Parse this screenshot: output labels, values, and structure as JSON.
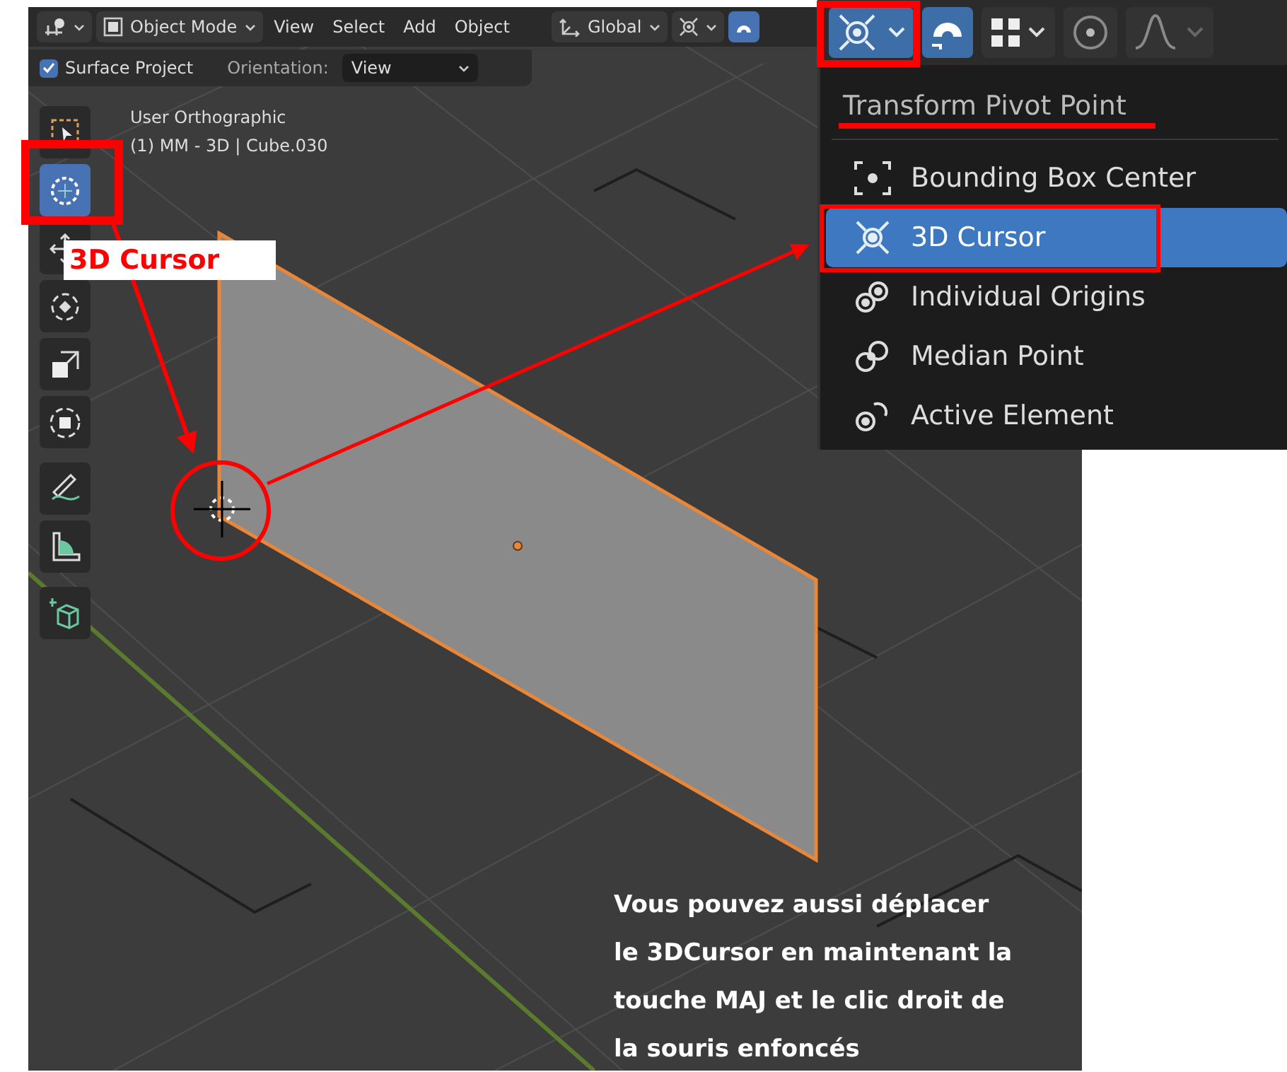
{
  "header": {
    "mode": "Object Mode",
    "menus": [
      "View",
      "Select",
      "Add",
      "Object"
    ],
    "orientation": "Global",
    "snap_on": true
  },
  "tool_settings": {
    "surface_project": {
      "label": "Surface Project",
      "checked": true
    },
    "orientation_label": "Orientation:",
    "orientation_value": "View"
  },
  "viewport": {
    "view_name": "User Orthographic",
    "object_info": "(1) MM - 3D | Cube.030"
  },
  "toolbar": [
    {
      "kind": "select",
      "selected": false
    },
    {
      "kind": "cursor",
      "selected": true
    },
    {
      "kind": "move",
      "selected": false
    },
    {
      "kind": "rotate",
      "selected": false
    },
    {
      "kind": "scale",
      "selected": false
    },
    {
      "kind": "transform",
      "selected": false
    },
    {
      "kind": "annotate",
      "selected": false
    },
    {
      "kind": "measure",
      "selected": false
    },
    {
      "kind": "add_cube",
      "selected": false
    }
  ],
  "pivot_popup": {
    "buttons": [
      {
        "kind": "pivot",
        "on": true
      },
      {
        "kind": "snap",
        "on": true
      },
      {
        "kind": "snap_target",
        "on": false
      },
      {
        "kind": "proportional",
        "on": false
      },
      {
        "kind": "falloff",
        "on": false
      }
    ],
    "title": "Transform Pivot Point",
    "items": [
      {
        "kind": "bbox",
        "label": "Bounding Box Center",
        "selected": false
      },
      {
        "kind": "cursor",
        "label": "3D Cursor",
        "selected": true
      },
      {
        "kind": "individual",
        "label": "Individual Origins",
        "selected": false
      },
      {
        "kind": "median",
        "label": "Median Point",
        "selected": false
      },
      {
        "kind": "active",
        "label": "Active Element",
        "selected": false
      }
    ]
  },
  "annotations": {
    "callout": "3D Cursor",
    "note": "Vous pouvez aussi déplacer le 3DCursor en maintenant la touche MAJ et le clic droit de la souris enfoncés"
  }
}
